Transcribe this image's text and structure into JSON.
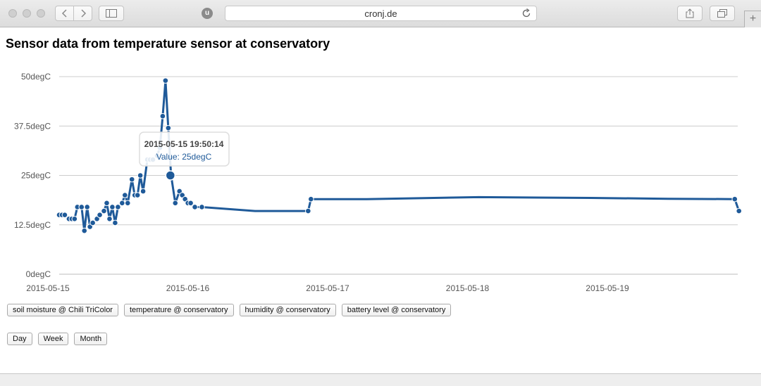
{
  "browser": {
    "url": "cronj.de",
    "extension_label": "u"
  },
  "page": {
    "title": "Sensor data from temperature sensor at conservatory"
  },
  "tooltip": {
    "title": "2015-05-15 19:50:14",
    "value_text": "Value: 25degC",
    "point": {
      "x": 0.795,
      "y": 25
    }
  },
  "sensor_buttons": [
    {
      "label": "soil moisture @ Chili TriColor"
    },
    {
      "label": "temperature @ conservatory"
    },
    {
      "label": "humidity @ conservatory"
    },
    {
      "label": "battery level @ conservatory"
    }
  ],
  "range_buttons": [
    {
      "label": "Day"
    },
    {
      "label": "Week"
    },
    {
      "label": "Month"
    }
  ],
  "colors": {
    "series": "#1f5a99",
    "grid": "#cccccc"
  },
  "chart_data": {
    "type": "line",
    "title": "",
    "xlabel": "",
    "ylabel": "",
    "ylim": [
      0,
      50
    ],
    "yticks": [
      "0degC",
      "12.5degC",
      "25degC",
      "37.5degC",
      "50degC"
    ],
    "ytick_values": [
      0,
      12.5,
      25,
      37.5,
      50
    ],
    "xticks": [
      "2015-05-15",
      "2015-05-16",
      "2015-05-17",
      "2015-05-18",
      "2015-05-19"
    ],
    "x_unit": "days after 2015-05-15 00:00",
    "xlim": [
      0,
      4.86
    ],
    "grid": true,
    "series": [
      {
        "name": "temperature @ conservatory",
        "points": [
          [
            0.0,
            15
          ],
          [
            0.02,
            15
          ],
          [
            0.04,
            15
          ],
          [
            0.07,
            14
          ],
          [
            0.09,
            14
          ],
          [
            0.11,
            14
          ],
          [
            0.13,
            17
          ],
          [
            0.16,
            17
          ],
          [
            0.18,
            11
          ],
          [
            0.2,
            17
          ],
          [
            0.22,
            12
          ],
          [
            0.24,
            13
          ],
          [
            0.27,
            14
          ],
          [
            0.29,
            15
          ],
          [
            0.32,
            16
          ],
          [
            0.34,
            18
          ],
          [
            0.36,
            14
          ],
          [
            0.38,
            17
          ],
          [
            0.4,
            13
          ],
          [
            0.42,
            17
          ],
          [
            0.45,
            18
          ],
          [
            0.47,
            20
          ],
          [
            0.49,
            18
          ],
          [
            0.52,
            24
          ],
          [
            0.54,
            20
          ],
          [
            0.56,
            20
          ],
          [
            0.58,
            25
          ],
          [
            0.6,
            21
          ],
          [
            0.63,
            29
          ],
          [
            0.65,
            29
          ],
          [
            0.67,
            29
          ],
          [
            0.7,
            30
          ],
          [
            0.72,
            32
          ],
          [
            0.74,
            40
          ],
          [
            0.76,
            49
          ],
          [
            0.78,
            37
          ],
          [
            0.8,
            25
          ],
          [
            0.83,
            18
          ],
          [
            0.86,
            21
          ],
          [
            0.88,
            20
          ],
          [
            0.9,
            19
          ],
          [
            0.92,
            18
          ],
          [
            0.94,
            18
          ],
          [
            0.97,
            17
          ],
          [
            1.02,
            17
          ],
          [
            1.4,
            16
          ],
          [
            1.7,
            16
          ],
          [
            1.78,
            16
          ],
          [
            1.8,
            19
          ],
          [
            2.2,
            19
          ],
          [
            3.0,
            19.5
          ],
          [
            3.8,
            19.3
          ],
          [
            4.35,
            19.1
          ],
          [
            4.83,
            19
          ],
          [
            4.86,
            16
          ]
        ]
      }
    ]
  }
}
